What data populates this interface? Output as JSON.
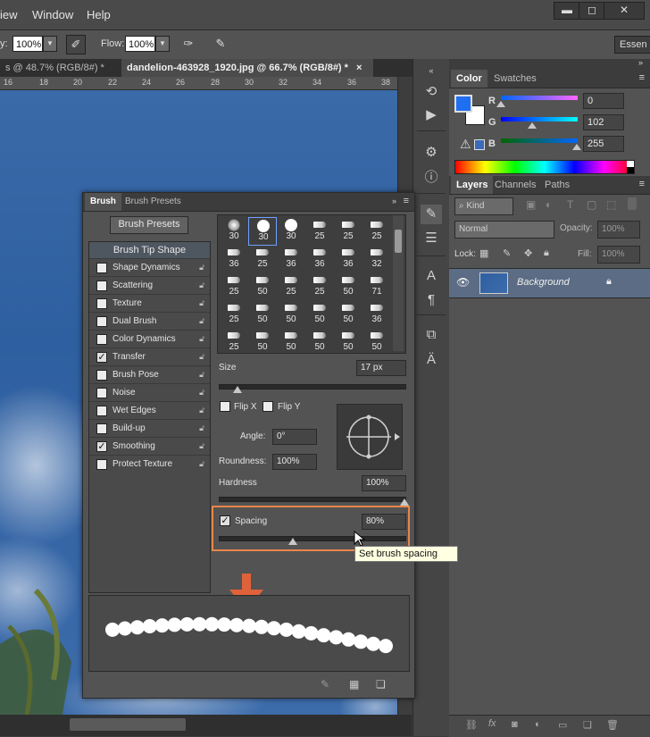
{
  "menu": {
    "items": [
      "iew",
      "Window",
      "Help"
    ]
  },
  "window_controls": {
    "minimize": "▬",
    "restore": "◻",
    "close": "✕"
  },
  "options": {
    "opacity_label": "y:",
    "opacity_value": "100%",
    "flow_label": "Flow:",
    "flow_value": "100%",
    "workspace": "Essen"
  },
  "doc_tabs": [
    {
      "label": "s @ 48.7% (RGB/8#) *",
      "close": "×",
      "active": false
    },
    {
      "label": "dandelion-463928_1920.jpg @ 66.7% (RGB/8#) *",
      "close": "×",
      "active": true
    }
  ],
  "ruler": {
    "ticks": [
      "16",
      "18",
      "20",
      "22",
      "24",
      "26",
      "28",
      "30",
      "32",
      "34",
      "36",
      "38"
    ]
  },
  "color_panel": {
    "tabs": [
      "Color",
      "Swatches"
    ],
    "foreground": "#1f6ff2",
    "background": "#ffffff",
    "channels": [
      {
        "label": "R",
        "value": "0",
        "level": 0.0
      },
      {
        "label": "G",
        "value": "102",
        "level": 0.4
      },
      {
        "label": "B",
        "value": "255",
        "level": 1.0
      }
    ]
  },
  "layers_panel": {
    "tabs": [
      "Layers",
      "Channels",
      "Paths"
    ],
    "filter_kind": "Kind",
    "blend_mode": "Normal",
    "opacity_label": "Opacity:",
    "opacity_value": "100%",
    "lock_label": "Lock:",
    "fill_label": "Fill:",
    "fill_value": "100%",
    "layers": [
      {
        "name": "Background",
        "locked": true,
        "visible": true
      }
    ]
  },
  "brush_panel": {
    "tabs": [
      "Brush",
      "Brush Presets"
    ],
    "presets_button": "Brush Presets",
    "options": [
      {
        "label": "Brush Tip Shape",
        "header": true
      },
      {
        "label": "Shape Dynamics",
        "checked": false
      },
      {
        "label": "Scattering",
        "checked": false
      },
      {
        "label": "Texture",
        "checked": false
      },
      {
        "label": "Dual Brush",
        "checked": false
      },
      {
        "label": "Color Dynamics",
        "checked": false
      },
      {
        "label": "Transfer",
        "checked": true
      },
      {
        "label": "Brush Pose",
        "checked": false
      },
      {
        "label": "Noise",
        "checked": false
      },
      {
        "label": "Wet Edges",
        "checked": false
      },
      {
        "label": "Build-up",
        "checked": false
      },
      {
        "label": "Smoothing",
        "checked": true
      },
      {
        "label": "Protect Texture",
        "checked": false
      }
    ],
    "tips": [
      "30",
      "30",
      "30",
      "25",
      "25",
      "25",
      "36",
      "25",
      "36",
      "36",
      "36",
      "32",
      "25",
      "50",
      "25",
      "25",
      "50",
      "71",
      "25",
      "50",
      "50",
      "50",
      "50",
      "36",
      "25",
      "50",
      "50",
      "50",
      "50",
      "50"
    ],
    "size_label": "Size",
    "size_value": "17 px",
    "size_level": 0.1,
    "flip_x": "Flip X",
    "flip_y": "Flip Y",
    "angle_label": "Angle:",
    "angle_value": "0°",
    "roundness_label": "Roundness:",
    "roundness_value": "100%",
    "hardness_label": "Hardness",
    "hardness_value": "100%",
    "hardness_level": 1.0,
    "spacing_label": "Spacing",
    "spacing_value": "80%",
    "spacing_checked": true,
    "spacing_level": 0.4,
    "tooltip": "Set brush spacing"
  }
}
